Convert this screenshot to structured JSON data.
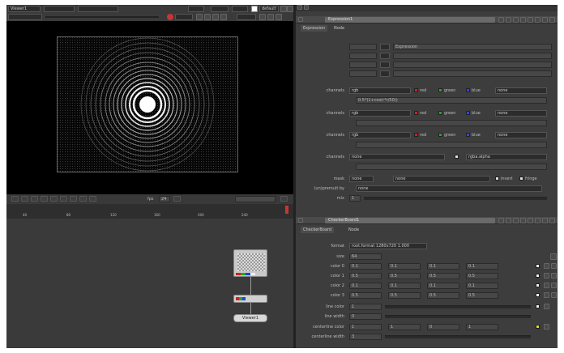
{
  "top": {
    "viewer_dd": "Viewer1",
    "proxy_dd": "",
    "layer_dd": "",
    "channel_dd": "",
    "frame_dd": "",
    "gain_dd": "",
    "default_dd": "default"
  },
  "viewer": {
    "tl_label": "",
    "br_label": ""
  },
  "transport": {
    "frame_label": "fps",
    "frame_value": "24"
  },
  "ruler_ticks": [
    "40",
    "80",
    "120",
    "160",
    "200",
    "240"
  ],
  "nodes": [
    {
      "label": ""
    },
    {
      "label": ""
    },
    {
      "label": "Viewer1"
    }
  ],
  "expr": {
    "title": "Expression1",
    "tabs": [
      "Expression",
      "Node"
    ],
    "expr_field": "Expression",
    "exprs": [
      "",
      "",
      "",
      ""
    ],
    "channel_label": "channels",
    "channel_rows": [
      {
        "value": "rgb",
        "opt": "none",
        "swatches": [
          {
            "name": "red",
            "color": "#cc2222"
          },
          {
            "name": "green",
            "color": "#22aa22"
          },
          {
            "name": "blue",
            "color": "#3344dd"
          }
        ],
        "expr": "0.5*(1+cos(r*r/50))"
      },
      {
        "value": "rgb",
        "opt": "none",
        "swatches": [
          {
            "name": "red",
            "color": "#cc2222"
          },
          {
            "name": "green",
            "color": "#22aa22"
          },
          {
            "name": "blue",
            "color": "#3344dd"
          }
        ],
        "expr": ""
      },
      {
        "value": "rgb",
        "opt": "none",
        "swatches": [
          {
            "name": "red",
            "color": "#cc2222"
          },
          {
            "name": "green",
            "color": "#22aa22"
          },
          {
            "name": "blue",
            "color": "#3344dd"
          }
        ],
        "expr": ""
      },
      {
        "value": "none",
        "opt": "rgba.alpha",
        "swatches": [],
        "expr": ""
      }
    ],
    "mask": {
      "label": "mask",
      "value": "none",
      "opt": "none",
      "invert_label": "invert",
      "fringe_label": "fringe"
    },
    "premult": {
      "label": "(un)premult by",
      "value": "none"
    },
    "mix": {
      "label": "mix",
      "value": "1"
    }
  },
  "checker": {
    "title": "CheckerBoard1",
    "tabs": [
      "CheckerBoard",
      "Node"
    ],
    "format": {
      "label": "format",
      "value": "root.format 1280x720 1.000"
    },
    "size": {
      "label": "size",
      "value": "64"
    },
    "colors": [
      {
        "label": "color 0",
        "vals": [
          "0.1",
          "0.1",
          "0.1",
          "0.1"
        ]
      },
      {
        "label": "color 1",
        "vals": [
          "0.5",
          "0.5",
          "0.5",
          "0.5"
        ]
      },
      {
        "label": "color 2",
        "vals": [
          "0.1",
          "0.1",
          "0.1",
          "0.1"
        ]
      },
      {
        "label": "color 3",
        "vals": [
          "0.5",
          "0.5",
          "0.5",
          "0.5"
        ]
      }
    ],
    "line_color": {
      "label": "line color",
      "value": "1"
    },
    "line_width": {
      "label": "line width",
      "value": "0"
    },
    "centerline_color": {
      "label": "centerline color",
      "vals": [
        "1",
        "1",
        "0",
        "1"
      ]
    },
    "centerline_width": {
      "label": "centerline width",
      "value": "3"
    }
  },
  "colors": {
    "bg": "#353535",
    "viewer": "#000000",
    "accent": "#cc3333"
  }
}
